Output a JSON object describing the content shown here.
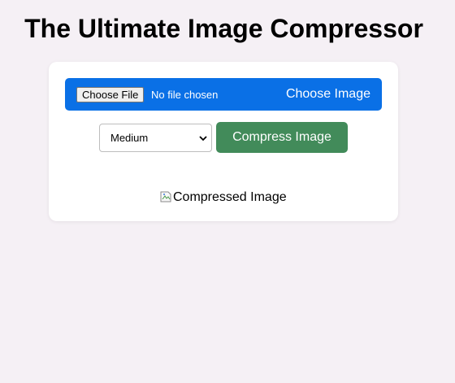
{
  "header": {
    "title": "The Ultimate Image Compressor"
  },
  "upload": {
    "file_button_label": "Choose File",
    "file_status": "No file chosen",
    "choose_label": "Choose Image"
  },
  "controls": {
    "quality_selected": "Medium",
    "compress_label": "Compress Image"
  },
  "result": {
    "alt_text": "Compressed Image"
  },
  "colors": {
    "background": "#f5f0f5",
    "card": "#ffffff",
    "upload_bar": "#0a70e6",
    "compress_button": "#428b5a"
  }
}
